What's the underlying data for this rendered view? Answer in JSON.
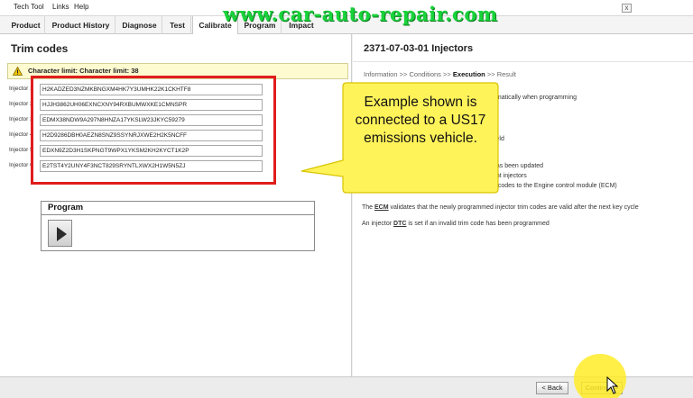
{
  "menubar": {
    "items": [
      "Tech Tool",
      "Links",
      "Help"
    ],
    "close_label": "x"
  },
  "watermark": "www.car-auto-repair.com",
  "tabs": [
    "Product",
    "Product History",
    "Diagnose",
    "Test",
    "Calibrate",
    "Program",
    "Impact"
  ],
  "active_tab": "Calibrate",
  "left": {
    "title": "Trim codes",
    "limit_text": "Character limit: Character limit: 38",
    "injectors": [
      {
        "label": "Injector 1",
        "value": "H2KADZED3NZMKBNGXM4HK7Y3UMHK22K1CKHTF8"
      },
      {
        "label": "Injector 2",
        "value": "HJJH3862UH06EXNCXNY94RXBUMWXKE1CMNSPR"
      },
      {
        "label": "Injector 3",
        "value": "EDMX38NDW9A297N8HNZA17YKSLW23JKYC59279"
      },
      {
        "label": "Injector 4",
        "value": "H2D9286DBH0AEZN8SNZ9SSYNRJXWE2H2K5NCFF"
      },
      {
        "label": "Injector 5",
        "value": "EDXN9Z2D3H1SKPNGT9WPX1YKSM2KH2KYCT1K2P"
      },
      {
        "label": "Injector 6",
        "value": "E2TST4Y2UNY4F3NCT829SRYNTLXWX2H1W5N5ZJ"
      }
    ],
    "program": {
      "title": "Program"
    }
  },
  "right": {
    "title": "2371-07-03-01 Injectors",
    "crumb": {
      "a": "Information",
      "sep1": ">>",
      "b": "Conditions",
      "sep2": ">>",
      "c": "Execution",
      "sep3": ">>",
      "d": "Result"
    },
    "partial": [
      "omatically when programming",
      "field",
      "has been updated",
      "ant injectors",
      "n codes to the Engine control module (ECM)"
    ],
    "line_ecm": {
      "pre": "The",
      "abbr": "ECM",
      "post": "validates that the newly programmed injector trim codes are valid after the next key cycle"
    },
    "line_dtc": {
      "pre": "An injector",
      "abbr": "DTC",
      "post": "is set if an invalid trim code has been programmed"
    }
  },
  "callout": {
    "text": "Example shown is connected to a US17 emissions vehicle."
  },
  "buttons": {
    "back": "< Back",
    "continue": "Continue >"
  },
  "colors": {
    "watermark": "#18d33a",
    "highlight_box": "#e01d1d",
    "callout": "#fff35a",
    "limit_bar": "#fffbd0"
  }
}
